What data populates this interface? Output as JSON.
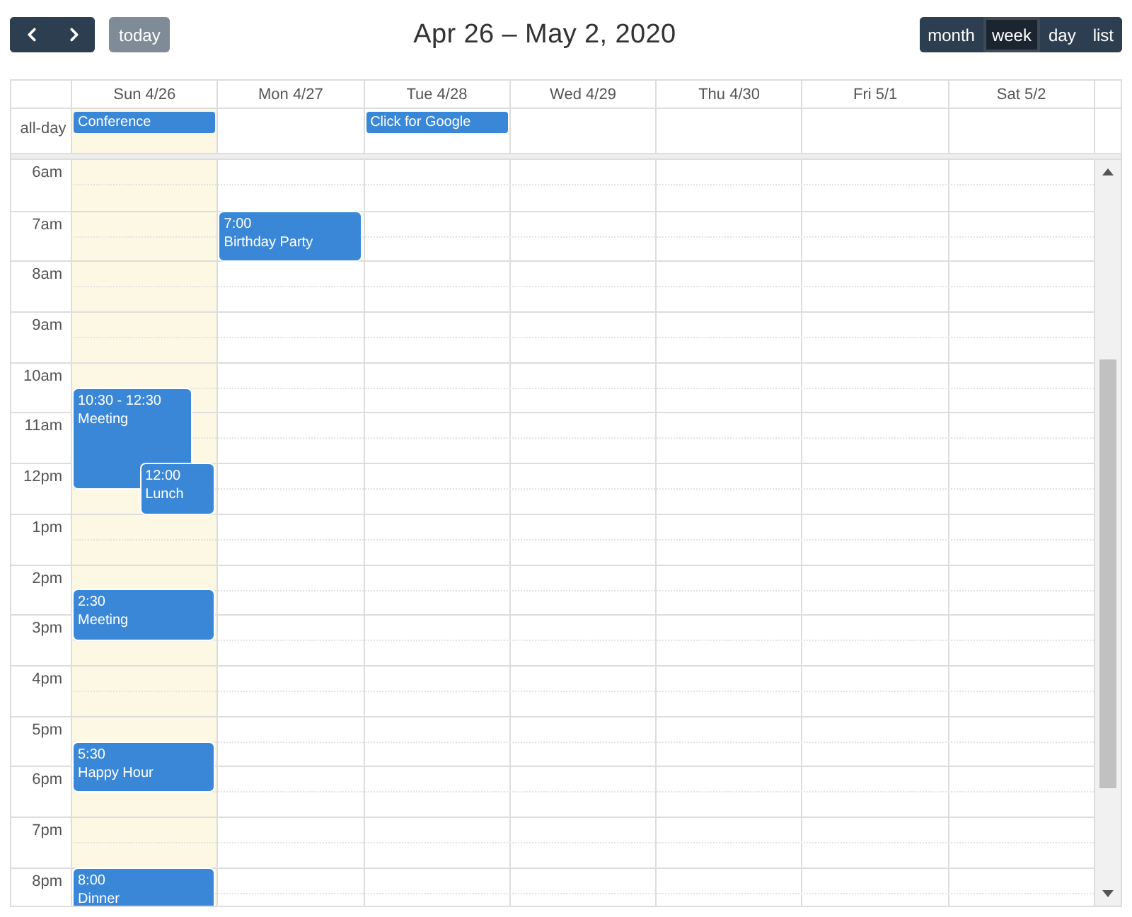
{
  "toolbar": {
    "today_button": {
      "label": "today",
      "disabled": true
    },
    "title": "Apr 26 – May 2, 2020",
    "views": [
      {
        "label": "month",
        "selected": false
      },
      {
        "label": "week",
        "selected": true
      },
      {
        "label": "day",
        "selected": false
      },
      {
        "label": "list",
        "selected": false
      }
    ]
  },
  "all_day_label": "all-day",
  "days": [
    {
      "label": "Sun 4/26",
      "today": true,
      "all_day": [
        {
          "title": "Conference"
        }
      ]
    },
    {
      "label": "Mon 4/27",
      "today": false
    },
    {
      "label": "Tue 4/28",
      "today": false,
      "all_day": [
        {
          "title": "Click for Google"
        }
      ]
    },
    {
      "label": "Wed 4/29",
      "today": false
    },
    {
      "label": "Thu 4/30",
      "today": false
    },
    {
      "label": "Fri 5/1",
      "today": false
    },
    {
      "label": "Sat 5/2",
      "today": false
    }
  ],
  "time_rows": [
    {
      "label": "6am"
    },
    {
      "label": "7am",
      "cells": [
        {},
        {
          "events": [
            {
              "time": "7:00",
              "title": "Birthday Party"
            }
          ]
        },
        {},
        {},
        {},
        {},
        {}
      ]
    },
    {
      "label": "8am"
    },
    {
      "label": "9am"
    },
    {
      "label": "10am",
      "cells": [
        {
          "events": [
            {
              "time": "10:30 - 12:30",
              "title": "Meeting"
            }
          ]
        },
        {},
        {},
        {},
        {},
        {},
        {}
      ]
    },
    {
      "label": "11am"
    },
    {
      "label": "12pm",
      "cells": [
        {
          "events": [
            {
              "time": "12:00",
              "title": "Lunch"
            }
          ]
        },
        {},
        {},
        {},
        {},
        {},
        {}
      ]
    },
    {
      "label": "1pm"
    },
    {
      "label": "2pm",
      "cells": [
        {
          "events": [
            {
              "time": "2:30",
              "title": "Meeting"
            }
          ]
        },
        {},
        {},
        {},
        {},
        {},
        {}
      ]
    },
    {
      "label": "3pm"
    },
    {
      "label": "4pm"
    },
    {
      "label": "5pm",
      "cells": [
        {
          "events": [
            {
              "time": "5:30",
              "title": "Happy Hour"
            }
          ]
        },
        {},
        {},
        {},
        {},
        {},
        {}
      ]
    },
    {
      "label": "6pm"
    },
    {
      "label": "7pm"
    },
    {
      "label": "8pm",
      "cells": [
        {
          "events": [
            {
              "time": "8:00",
              "title": "Dinner"
            }
          ]
        },
        {},
        {},
        {},
        {},
        {},
        {}
      ]
    }
  ]
}
